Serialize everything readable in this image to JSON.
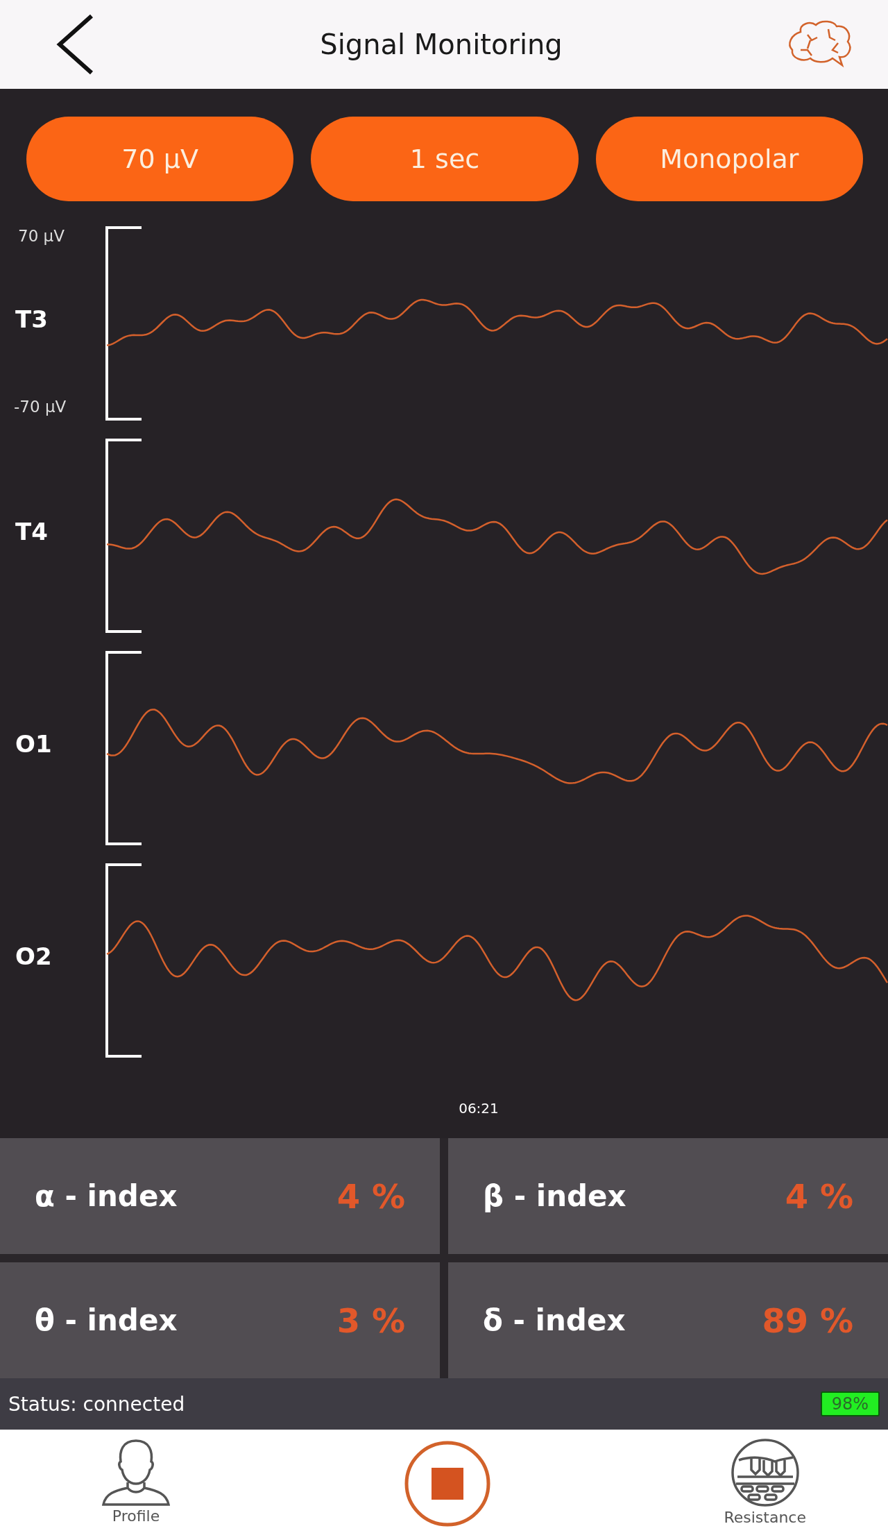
{
  "header": {
    "title": "Signal Monitoring"
  },
  "settings": [
    {
      "label": "70 µV"
    },
    {
      "label": "1 sec"
    },
    {
      "label": "Monopolar"
    }
  ],
  "channels": [
    {
      "name": "T3",
      "scale_top": "70 µV",
      "scale_bottom": "-70 µV"
    },
    {
      "name": "T4"
    },
    {
      "name": "O1"
    },
    {
      "name": "O2"
    }
  ],
  "time": "06:21",
  "indices": [
    {
      "label": "α - index",
      "value": "4 %"
    },
    {
      "label": "β - index",
      "value": "4 %"
    },
    {
      "label": "θ - index",
      "value": "3 %"
    },
    {
      "label": "δ - index",
      "value": "89 %"
    }
  ],
  "status_bar": {
    "status": "Status: connected",
    "battery": "98%"
  },
  "nav": [
    {
      "kind": "profile",
      "label": "Profile"
    },
    {
      "kind": "stop"
    },
    {
      "kind": "resistance",
      "label": "Resistance"
    }
  ]
}
